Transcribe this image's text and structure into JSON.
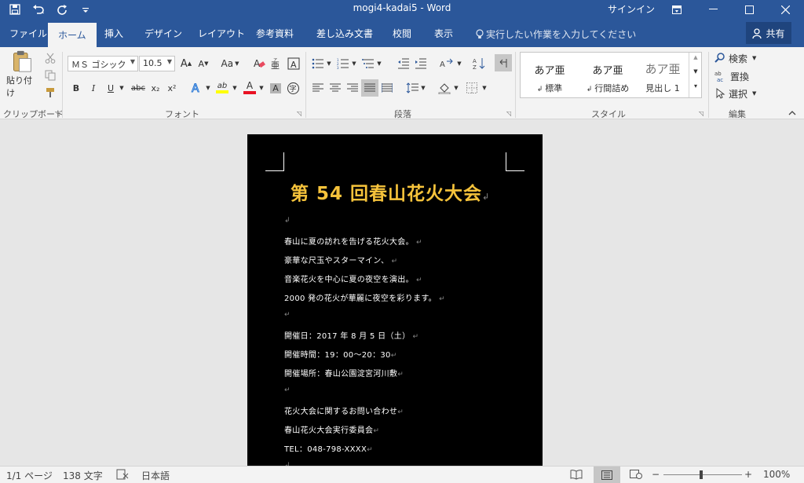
{
  "title_bar": {
    "document_title": "mogi4-kadai5  -  Word",
    "signin": "サインイン",
    "icons": [
      "save-icon",
      "undo-icon",
      "redo-icon",
      "customize-qat-icon",
      "ribbon-display-icon",
      "minimize-icon",
      "maximize-icon",
      "close-icon"
    ]
  },
  "tabs": [
    "ファイル",
    "ホーム",
    "挿入",
    "デザイン",
    "レイアウト",
    "参考資料",
    "差し込み文書",
    "校閲",
    "表示"
  ],
  "active_tab": "ホーム",
  "tell_me": "実行したい作業を入力してください",
  "share": "共有",
  "ribbon": {
    "clipboard": {
      "label": "クリップボード",
      "paste": "貼り付け"
    },
    "font": {
      "label": "フォント",
      "font_name": "ＭＳ ゴシック",
      "font_size": "10.5",
      "grow": "A",
      "shrink": "A",
      "change_case": "Aa",
      "bold": "B",
      "italic": "I",
      "underline": "U",
      "strikethrough": "abc",
      "subscript": "x₂",
      "superscript": "x²",
      "highlight": "ab",
      "font_color": "A",
      "char_shading": "A",
      "enclose": "字"
    },
    "paragraph": {
      "label": "段落"
    },
    "styles": {
      "label": "スタイル",
      "items": [
        {
          "preview": "あア亜",
          "name": "標準"
        },
        {
          "preview": "あア亜",
          "name": "行間詰め"
        },
        {
          "preview": "あア亜",
          "name": "見出し 1"
        }
      ]
    },
    "editing": {
      "label": "編集",
      "find": "検索",
      "replace": "置換",
      "select": "選択"
    }
  },
  "document": {
    "heading": "第 54 回春山花火大会",
    "lines": [
      "",
      "春山に夏の訪れを告げる花火大会。",
      "豪華な尺玉やスターマイン、",
      "音楽花火を中心に夏の夜空を演出。",
      "2000 発の花火が華麗に夜空を彩ります。",
      "",
      "開催日：2017 年 8 月 5 日（土）",
      "開催時間：19：00～20：30",
      "開催場所：春山公園淀宮河川敷",
      "",
      "花火大会に関するお問い合わせ",
      "春山花火大会実行委員会",
      "TEL：048-798-XXXX",
      ""
    ]
  },
  "status_bar": {
    "page": "1/1 ページ",
    "words": "138 文字",
    "language": "日本語",
    "zoom": "100%",
    "zoom_minus": "−",
    "zoom_plus": "+"
  },
  "colors": {
    "title_bar": "#2b579a",
    "ribbon": "#f3f3f3",
    "page_background": "#000000",
    "heading_text": "#f6c33b",
    "body_text": "#ffffff"
  }
}
